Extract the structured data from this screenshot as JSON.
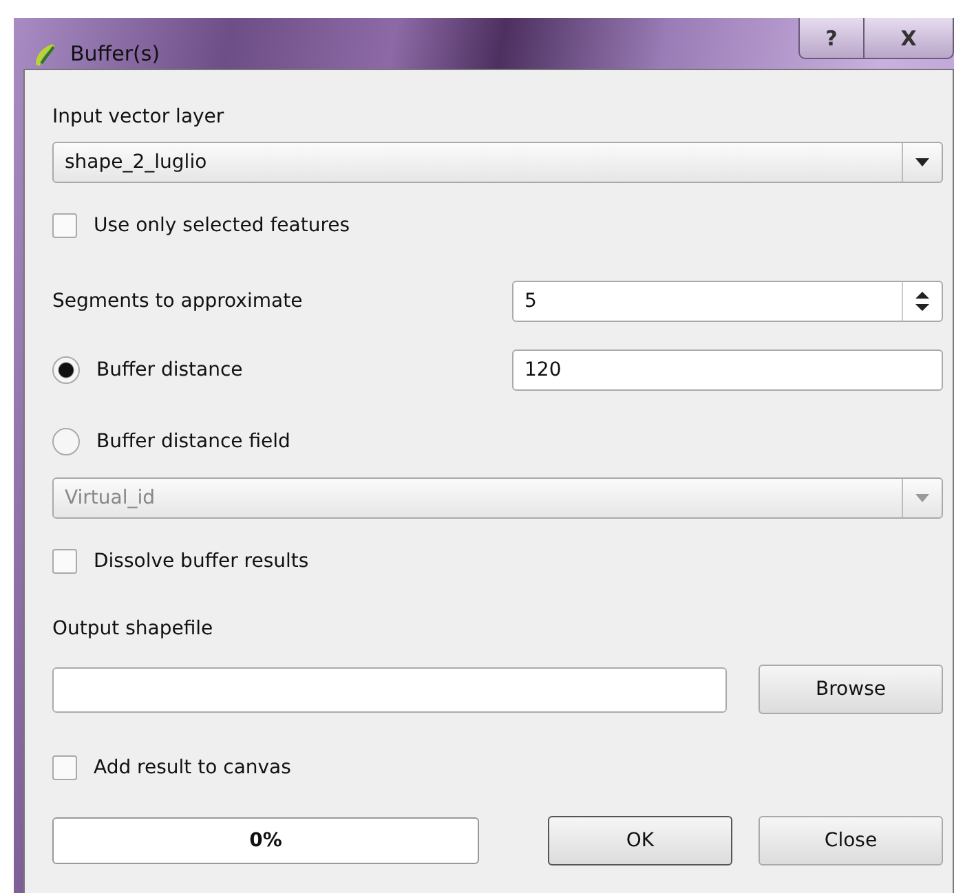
{
  "window": {
    "title": "Buffer(s)",
    "help_button": "?",
    "close_button": "X"
  },
  "input_layer": {
    "label": "Input vector layer",
    "value": "shape_2_luglio"
  },
  "use_selected": {
    "label": "Use only selected features",
    "checked": false
  },
  "segments": {
    "label": "Segments to approximate",
    "value": "5"
  },
  "distance_options": [
    {
      "label": "Buffer distance",
      "selected": true,
      "value": "120"
    },
    {
      "label": "Buffer distance field",
      "selected": false
    }
  ],
  "distance_field": {
    "value": "Virtual_id",
    "disabled": true
  },
  "dissolve": {
    "label": "Dissolve buffer results",
    "checked": false
  },
  "output": {
    "label": "Output shapefile",
    "browse": "Browse"
  },
  "add_to_canvas": {
    "label": "Add result to canvas",
    "checked": false
  },
  "progress": {
    "level": 0,
    "text": "0%"
  },
  "buttons": [
    {
      "label": "OK",
      "default": true
    },
    {
      "label": "Close",
      "default": false
    }
  ]
}
